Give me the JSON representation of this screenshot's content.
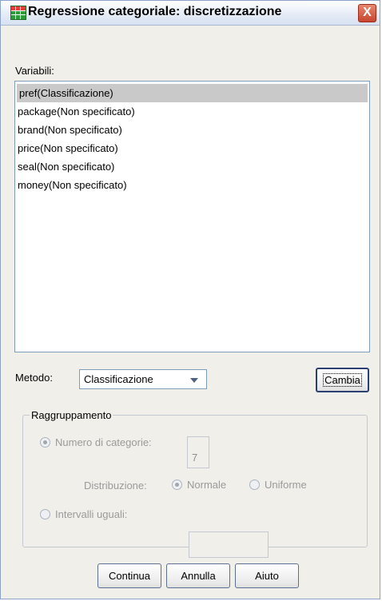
{
  "window": {
    "title": "Regressione categoriale: discretizzazione",
    "icon": "spreadsheet-icon",
    "close_symbol": "X"
  },
  "variables": {
    "label": "Variabili:",
    "items": [
      "pref(Classificazione)",
      "package(Non specificato)",
      "brand(Non specificato)",
      "price(Non specificato)",
      "seal(Non specificato)",
      "money(Non specificato)"
    ],
    "selected_index": 0
  },
  "method": {
    "label": "Metodo:",
    "value": "Classificazione",
    "change_button": "Cambia"
  },
  "grouping": {
    "title": "Raggruppamento",
    "num_categories_label": "Numero di categorie:",
    "num_categories_value": "7",
    "distribution_label": "Distribuzione:",
    "normal_label": "Normale",
    "uniform_label": "Uniforme",
    "equal_intervals_label": "Intervalli uguali:"
  },
  "buttons": {
    "continue": "Continua",
    "cancel": "Annulla",
    "help": "Aiuto"
  },
  "colors": {
    "dialog_bg": "#f0efe9",
    "selection": "#c9c9c9",
    "close_button": "#c7462e"
  }
}
